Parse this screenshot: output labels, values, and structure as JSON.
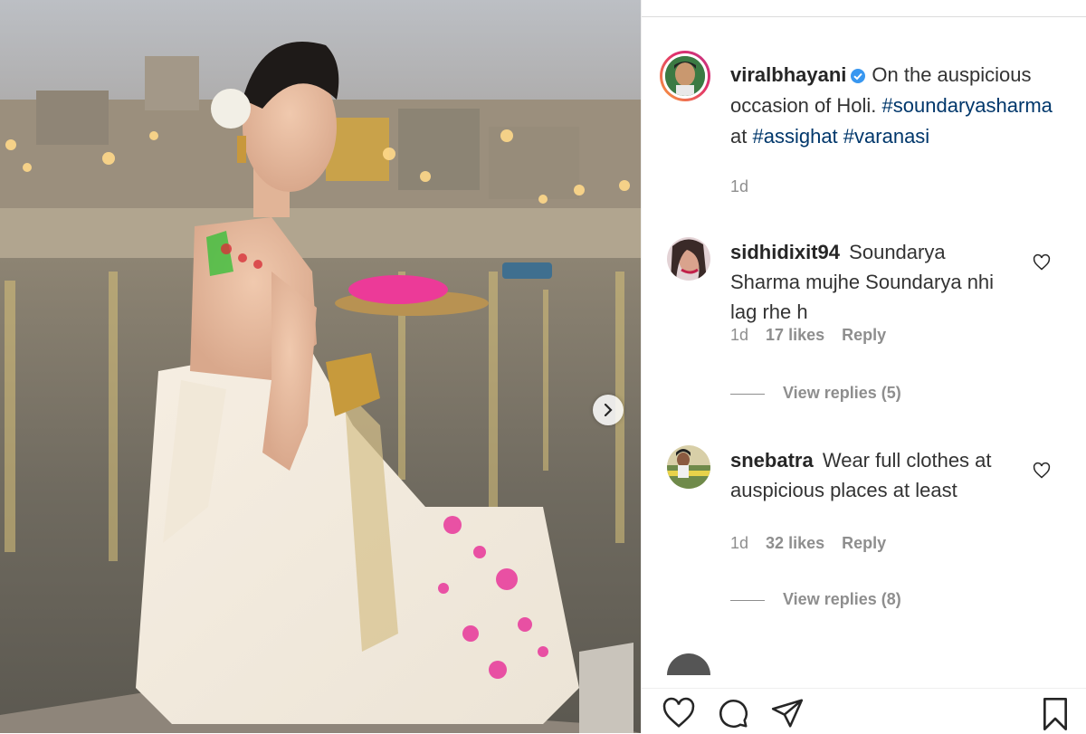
{
  "post": {
    "username": "viralbhayani",
    "caption": "On the auspicious occasion of Holi.",
    "hashtags": [
      "#soundaryasharma",
      "#assighat",
      "#varanasi"
    ],
    "connector": "at",
    "time": "1d",
    "verified_icon": "verified-badge-icon"
  },
  "comments": [
    {
      "username": "sidhidixit94",
      "text": "Soundarya Sharma mujhe Soundarya nhi lag rhe h",
      "time": "1d",
      "likes": "17 likes",
      "reply": "Reply",
      "view_replies": "View replies (5)"
    },
    {
      "username": "snebatra",
      "text": "Wear full clothes at auspicious places at least",
      "time": "1d",
      "likes": "32 likes",
      "reply": "Reply",
      "view_replies": "View replies (8)"
    }
  ],
  "colors": {
    "accent_link": "#00376b",
    "verified": "#3897f0",
    "muted": "#8e8e8e"
  },
  "icons": {
    "like": "heart-icon",
    "comment": "comment-icon",
    "share": "paper-plane-icon",
    "save": "bookmark-icon",
    "next": "chevron-right-icon"
  }
}
